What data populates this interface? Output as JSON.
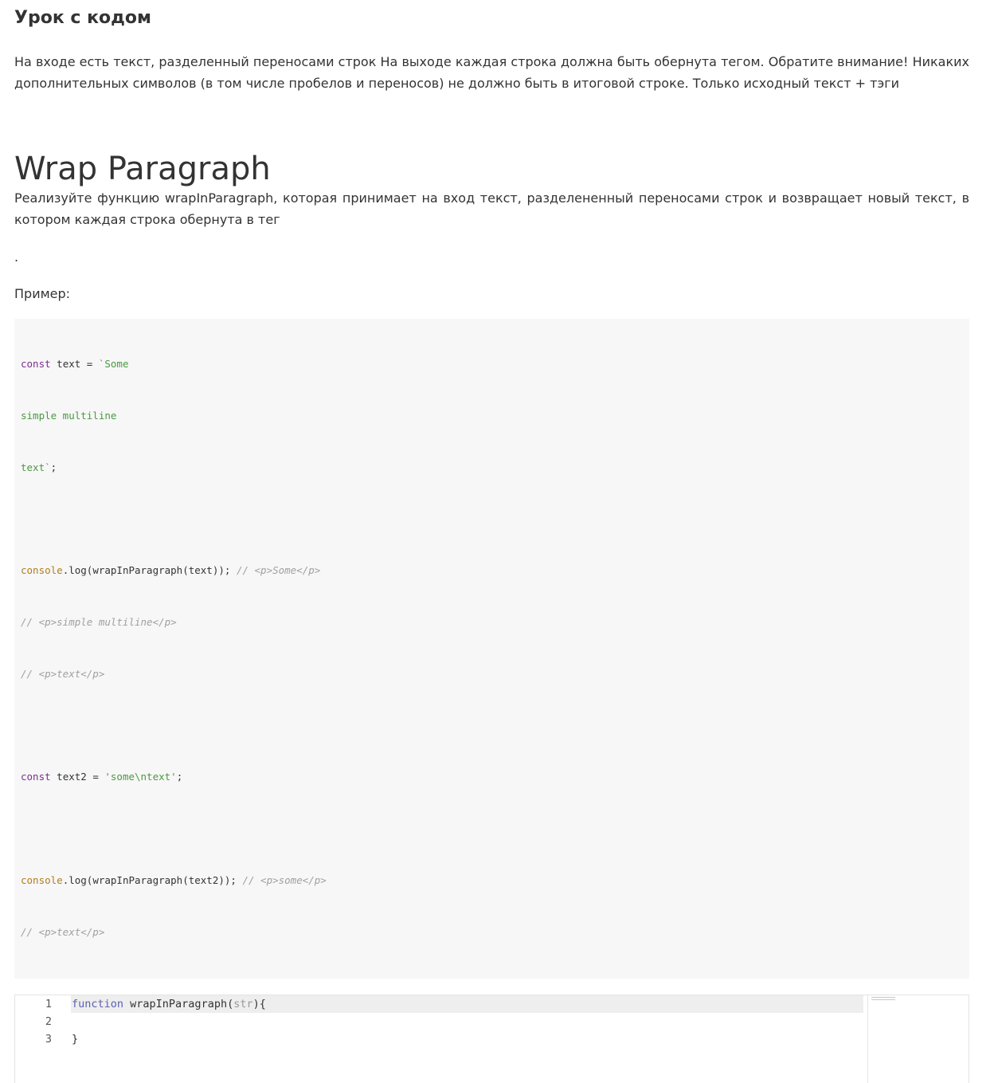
{
  "lesson": {
    "title": "Урок с кодом",
    "intro": "На входе есть текст, разделенный переносами строк На выходе каждая строка должна быть обернута тегом. Обратите внимание! Никаких дополнительных символов (в том числе пробелов и переносов) не должно быть в итоговой строке. Только исходный текст + тэги"
  },
  "task": {
    "title": "Wrap Paragraph",
    "description": "Реализуйте функцию wrapInParagraph, которая принимает на вход текст, разделененный переносами строк и возвращает новый текст, в котором каждая строка обернута в тег",
    "dot": ".",
    "example_label": "Пример:"
  },
  "example_code": {
    "l1_kw": "const",
    "l1_rest": " text = ",
    "l1_str": "`Some",
    "l2_str": "simple multiline",
    "l3_str": "text`",
    "l3_rest": ";",
    "l5_fn": "console",
    "l5_rest": ".log(wrapInParagraph(text)); ",
    "l5_com": "// <p>Some</p>",
    "l6_com": "// <p>simple multiline</p>",
    "l7_com": "// <p>text</p>",
    "l9_kw": "const",
    "l9_rest": " text2 = ",
    "l9_str": "'some\\ntext'",
    "l9_end": ";",
    "l11_fn": "console",
    "l11_rest": ".log(wrapInParagraph(text2)); ",
    "l11_com": "// <p>some</p>",
    "l12_com": "// <p>text</p>"
  },
  "editor": {
    "line_numbers": [
      "1",
      "2",
      "3"
    ],
    "line1_kw": "function",
    "line1_name": " wrapInParagraph(",
    "line1_param": "str",
    "line1_end": "){",
    "line3": "}"
  }
}
